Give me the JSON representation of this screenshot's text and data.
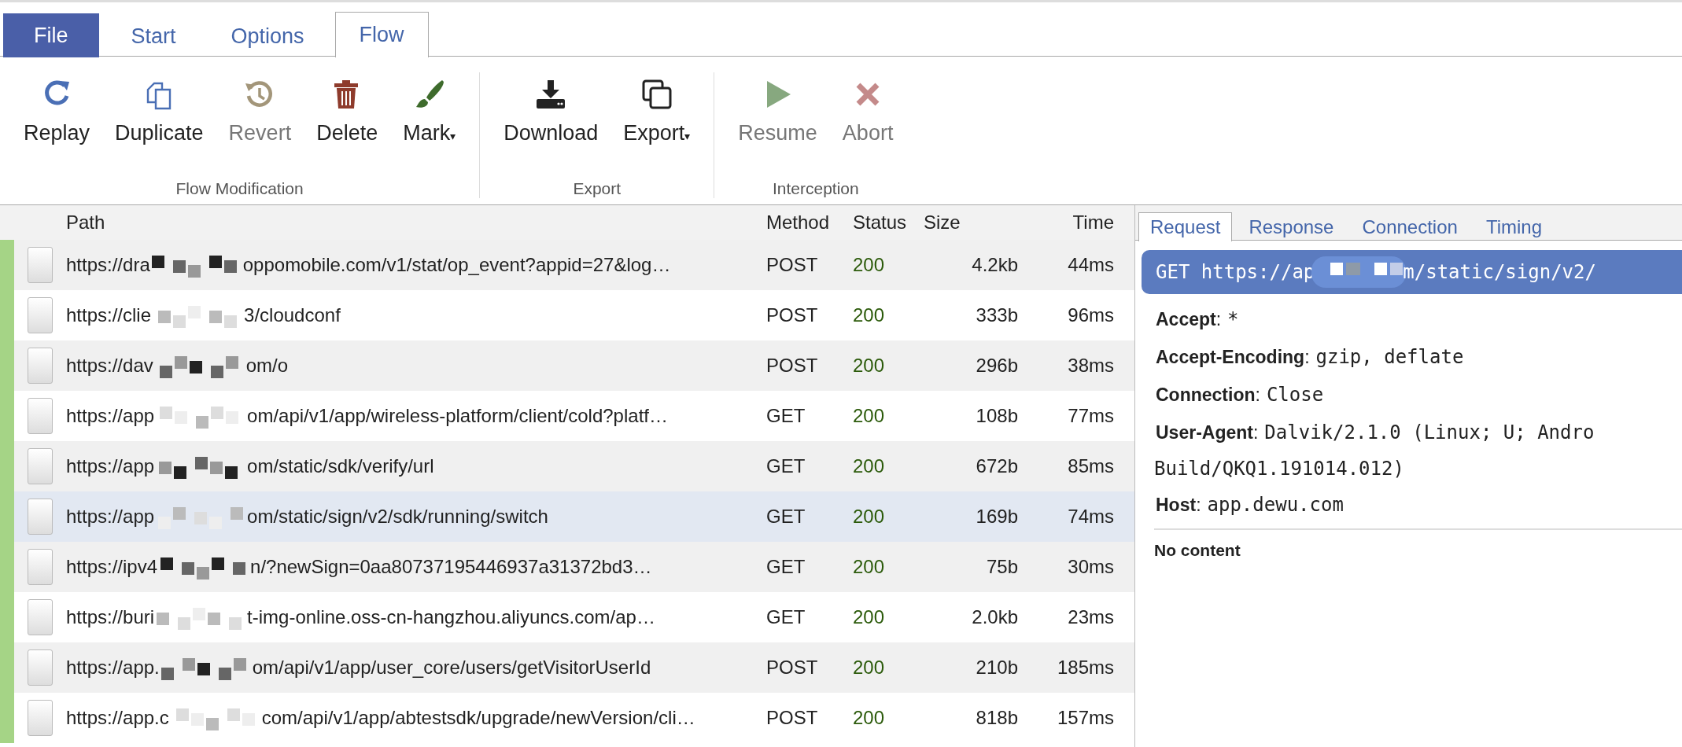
{
  "menu_tabs": [
    {
      "label": "File",
      "kind": "file",
      "selected": false
    },
    {
      "label": "Start",
      "kind": "tab",
      "selected": false
    },
    {
      "label": "Options",
      "kind": "tab",
      "selected": false
    },
    {
      "label": "Flow",
      "kind": "tab",
      "selected": true
    }
  ],
  "toolbar_groups": [
    {
      "label": "Flow Modification",
      "buttons": [
        {
          "label": "Replay",
          "disabled": false
        },
        {
          "label": "Duplicate",
          "disabled": false
        },
        {
          "label": "Revert",
          "disabled": true
        },
        {
          "label": "Delete",
          "disabled": false
        },
        {
          "label": "Mark",
          "caret": "▾",
          "disabled": false
        }
      ]
    },
    {
      "label": "Export",
      "buttons": [
        {
          "label": "Download",
          "disabled": false
        },
        {
          "label": "Export",
          "caret": "▾",
          "disabled": false
        }
      ]
    },
    {
      "label": "Interception",
      "buttons": [
        {
          "label": "Resume",
          "disabled": true
        },
        {
          "label": "Abort",
          "disabled": true
        }
      ]
    }
  ],
  "flow_table": {
    "columns": [
      "Path",
      "Method",
      "Status",
      "Size",
      "Time"
    ],
    "rows": [
      {
        "path_start": "https://dra",
        "path_end": "oppomobile.com/v1/stat/op_event?appid=27&log…",
        "method": "POST",
        "status": "200",
        "size": "4.2kb",
        "time": "44ms",
        "selected": false
      },
      {
        "path_start": "https://clie",
        "path_end": "3/cloudconf",
        "method": "POST",
        "status": "200",
        "size": "333b",
        "time": "96ms",
        "selected": false
      },
      {
        "path_start": "https://dav",
        "path_end": "om/o",
        "method": "POST",
        "status": "200",
        "size": "296b",
        "time": "38ms",
        "selected": false
      },
      {
        "path_start": "https://app",
        "path_end": "om/api/v1/app/wireless-platform/client/cold?platf…",
        "method": "GET",
        "status": "200",
        "size": "108b",
        "time": "77ms",
        "selected": false
      },
      {
        "path_start": "https://app",
        "path_end": "om/static/sdk/verify/url",
        "method": "GET",
        "status": "200",
        "size": "672b",
        "time": "85ms",
        "selected": false
      },
      {
        "path_start": "https://app",
        "path_end": "om/static/sign/v2/sdk/running/switch",
        "method": "GET",
        "status": "200",
        "size": "169b",
        "time": "74ms",
        "selected": true
      },
      {
        "path_start": "https://ipv4",
        "path_end": "n/?newSign=0aa80737195446937a31372bd3…",
        "method": "GET",
        "status": "200",
        "size": "75b",
        "time": "30ms",
        "selected": false
      },
      {
        "path_start": "https://buri",
        "path_end": "t-img-online.oss-cn-hangzhou.aliyuncs.com/ap…",
        "method": "GET",
        "status": "200",
        "size": "2.0kb",
        "time": "23ms",
        "selected": false
      },
      {
        "path_start": "https://app.",
        "path_end": "om/api/v1/app/user_core/users/getVisitorUserId",
        "method": "POST",
        "status": "200",
        "size": "210b",
        "time": "185ms",
        "selected": false
      },
      {
        "path_start": "https://app.c",
        "path_end": "com/api/v1/app/abtestsdk/upgrade/newVersion/cli…",
        "method": "POST",
        "status": "200",
        "size": "818b",
        "time": "157ms",
        "selected": false
      }
    ]
  },
  "detail": {
    "tabs": [
      {
        "label": "Request",
        "selected": true
      },
      {
        "label": "Response",
        "selected": false
      },
      {
        "label": "Connection",
        "selected": false
      },
      {
        "label": "Timing",
        "selected": false
      }
    ],
    "request_line_start": "GET https://ap",
    "request_line_end": "m/static/sign/v2/",
    "headers": [
      {
        "name": "Accept",
        "separator": ":",
        "value": "*"
      },
      {
        "name": "Accept-Encoding",
        "separator": ":",
        "value": "gzip, deflate"
      },
      {
        "name": "Connection",
        "separator": ":",
        "value": "Close"
      },
      {
        "name": "User-Agent",
        "separator": ":",
        "value": "Dalvik/2.1.0 (Linux; U; Andro",
        "value_line_2": "Build/QKQ1.191014.012)"
      },
      {
        "name": "Host",
        "separator": ":",
        "value": "app.dewu.com"
      }
    ],
    "body": "No content"
  }
}
